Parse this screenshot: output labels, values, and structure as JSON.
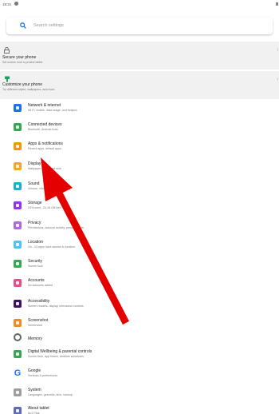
{
  "status_bar": {
    "time": "18:31"
  },
  "search": {
    "placeholder": "Search settings"
  },
  "cards": [
    {
      "title": "Secure your phone",
      "subtitle": "Set screen lock to protect tablet",
      "icon": "lock-icon"
    },
    {
      "title": "Customize your phone",
      "subtitle": "Try different styles, wallpapers, and more",
      "icon": "palette-icon"
    }
  ],
  "settings": [
    {
      "title": "Network & internet",
      "subtitle": "Wi-Fi, mobile, data usage, and hotspot",
      "icon": "wifi-icon",
      "color": "#1a73e8"
    },
    {
      "title": "Connected devices",
      "subtitle": "Bluetooth, Android Auto",
      "icon": "devices-icon",
      "color": "#34a853"
    },
    {
      "title": "Apps & notifications",
      "subtitle": "Recent apps, default apps",
      "icon": "apps-icon",
      "color": "#f29900"
    },
    {
      "title": "Display",
      "subtitle": "Wallpaper, sleep, font size",
      "icon": "display-icon",
      "color": "#f6a623"
    },
    {
      "title": "Sound",
      "subtitle": "Volume, vibration, Do Not Disturb",
      "icon": "sound-icon",
      "color": "#12b5cb"
    },
    {
      "title": "Storage",
      "subtitle": "24% used - 24.28 GB free",
      "icon": "storage-icon",
      "color": "#9334e6"
    },
    {
      "title": "Privacy",
      "subtitle": "Permissions, account activity, personal data",
      "icon": "privacy-icon",
      "color": "#b06ad8"
    },
    {
      "title": "Location",
      "subtitle": "On - 13 apps have access to location",
      "icon": "location-icon",
      "color": "#4fc3f7"
    },
    {
      "title": "Security",
      "subtitle": "Screen lock",
      "icon": "security-icon",
      "color": "#34a853"
    },
    {
      "title": "Accounts",
      "subtitle": "No accounts added",
      "icon": "accounts-icon",
      "color": "#ea4c89"
    },
    {
      "title": "Accessibility",
      "subtitle": "Screen readers, display, interaction controls",
      "icon": "accessibility-icon",
      "color": "#3c1361"
    },
    {
      "title": "Screenshot",
      "subtitle": "Screenshot",
      "icon": "screenshot-icon",
      "color": "#f28b22"
    },
    {
      "title": "Memory",
      "subtitle": "",
      "icon": "memory-icon",
      "color": "#5f6368"
    },
    {
      "title": "Digital Wellbeing & parental controls",
      "subtitle": "Screen time, app timers, bedtime schedules",
      "icon": "wellbeing-icon",
      "color": "#34a853"
    },
    {
      "title": "Google",
      "subtitle": "Services & preferences",
      "icon": "google-icon",
      "color": "#1a73e8"
    },
    {
      "title": "System",
      "subtitle": "Languages, gestures, time, backup",
      "icon": "system-icon",
      "color": "#9e9e9e"
    },
    {
      "title": "About tablet",
      "subtitle": "Au1 Plus",
      "icon": "info-icon",
      "color": "#5c6bc0"
    }
  ],
  "annotation": {
    "arrow_color": "#e50000"
  }
}
